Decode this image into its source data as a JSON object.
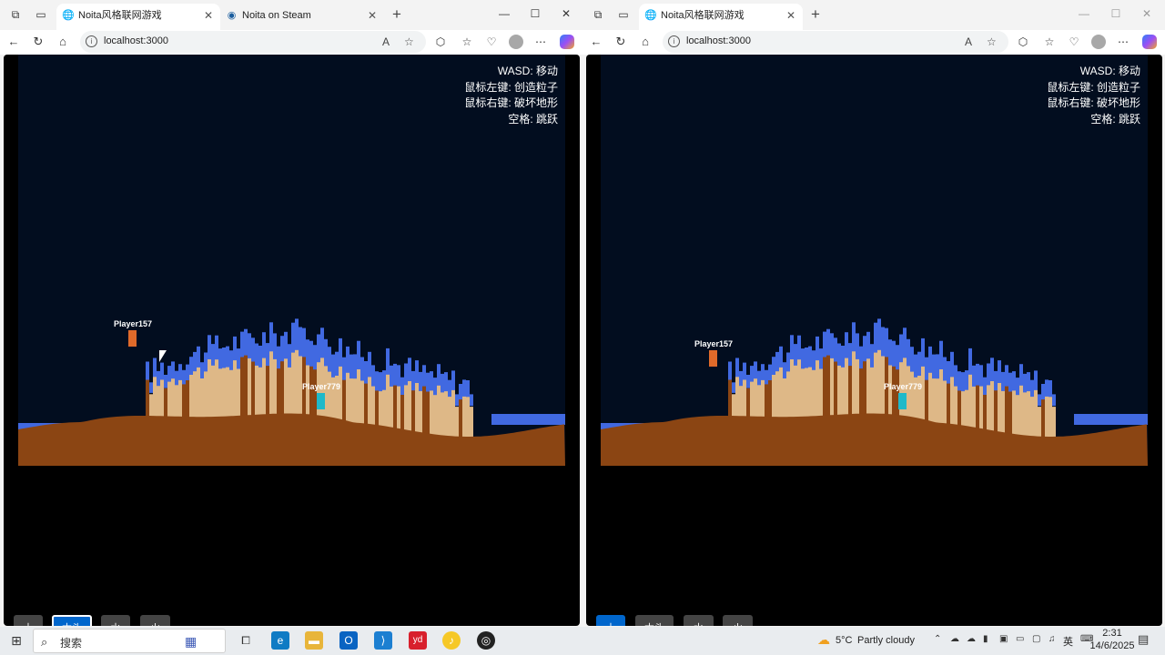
{
  "windows": [
    {
      "tabs": [
        {
          "title": "Noita风格联网游戏",
          "active": true
        },
        {
          "title": "Noita on Steam",
          "active": false
        }
      ],
      "url": "localhost:3000",
      "help_lines": [
        "WASD: 移动",
        "鼠标左键: 创造粒子",
        "鼠标右键: 破坏地形",
        "空格: 跳跃"
      ],
      "players": {
        "local": {
          "name": "Player157",
          "color": "#e06a2a"
        },
        "remote": {
          "name": "Player779",
          "color": "#1fb9c9"
        }
      },
      "materials": [
        {
          "label": "土",
          "active": false
        },
        {
          "label": "木头",
          "active": true
        },
        {
          "label": "水",
          "active": false
        },
        {
          "label": "火",
          "active": false
        }
      ]
    },
    {
      "tabs": [
        {
          "title": "Noita风格联网游戏",
          "active": true
        }
      ],
      "url": "localhost:3000",
      "help_lines": [
        "WASD: 移动",
        "鼠标左键: 创造粒子",
        "鼠标右键: 破坏地形",
        "空格: 跳跃"
      ],
      "players": {
        "local": {
          "name": "Player157",
          "color": "#e06a2a"
        },
        "remote": {
          "name": "Player779",
          "color": "#1fb9c9"
        }
      },
      "materials": [
        {
          "label": "土",
          "active": true
        },
        {
          "label": "木头",
          "active": false
        },
        {
          "label": "水",
          "active": false
        },
        {
          "label": "火",
          "active": false
        }
      ]
    }
  ],
  "colors": {
    "sky": "#020d1f",
    "dirt": "#8b4513",
    "sand": "#deb887",
    "water": "#4169e1",
    "active_button": "#0066cc",
    "button": "#444444"
  },
  "taskbar": {
    "search_placeholder": "搜索",
    "weather_temp": "5°C",
    "weather_text": "Partly cloudy",
    "ime_label": "英",
    "time": "2:31",
    "date": "14/6/2025"
  }
}
